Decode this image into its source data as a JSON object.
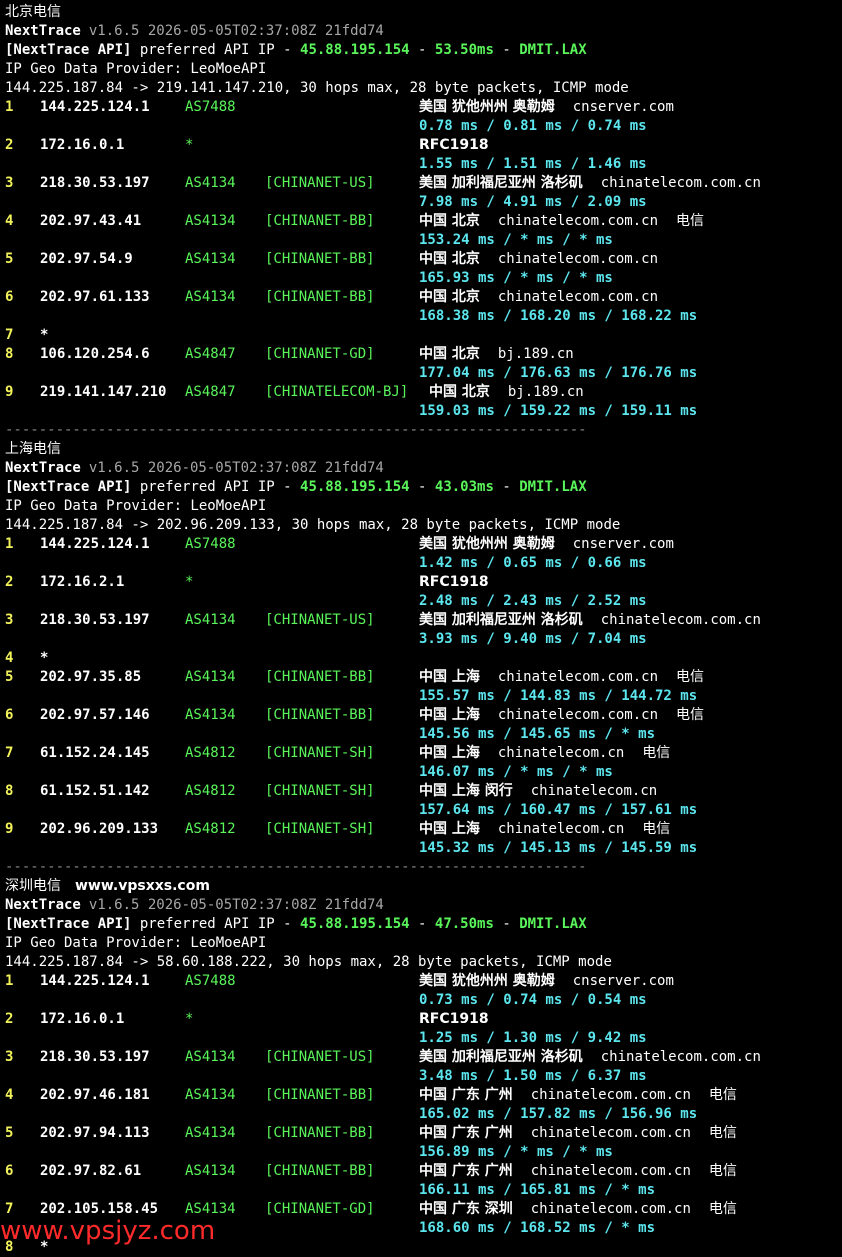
{
  "sections": [
    {
      "title": "北京电信",
      "watermark": "",
      "app": "NextTrace",
      "version": "v1.6.5 2026-05-05T02:37:08Z 21fdd74",
      "api_tag": "[NextTrace API]",
      "api_text": " preferred API IP - ",
      "api_ip": "45.88.195.154",
      "dash1": " - ",
      "api_latency": "53.50ms",
      "dash2": " - ",
      "api_node": "DMIT.LAX",
      "provider": "IP Geo Data Provider: LeoMoeAPI",
      "trace": "144.225.187.84 -> 219.141.147.210, 30 hops max, 28 byte packets, ICMP mode",
      "hops": [
        {
          "n": "1",
          "ip": "144.225.124.1",
          "as": "AS7488",
          "net": "",
          "geo": "美国 犹他州州 奥勒姆",
          "host": "cnserver.com",
          "isp": "",
          "rtt": "0.78 ms / 0.81 ms / 0.74 ms"
        },
        {
          "n": "2",
          "ip": "172.16.0.1",
          "as": "*",
          "net": "",
          "geo": "RFC1918",
          "host": "",
          "isp": "",
          "rtt": "1.55 ms / 1.51 ms / 1.46 ms"
        },
        {
          "n": "3",
          "ip": "218.30.53.197",
          "as": "AS4134",
          "net": "[CHINANET-US]",
          "geo": "美国 加利福尼亚州 洛杉矶",
          "host": "chinatelecom.com.cn",
          "isp": "",
          "rtt": "7.98 ms / 4.91 ms / 2.09 ms"
        },
        {
          "n": "4",
          "ip": "202.97.43.41",
          "as": "AS4134",
          "net": "[CHINANET-BB]",
          "geo": "中国 北京",
          "host": "chinatelecom.com.cn",
          "isp": "电信",
          "rtt": "153.24 ms / * ms / * ms"
        },
        {
          "n": "5",
          "ip": "202.97.54.9",
          "as": "AS4134",
          "net": "[CHINANET-BB]",
          "geo": "中国 北京",
          "host": "chinatelecom.com.cn",
          "isp": "",
          "rtt": "165.93 ms / * ms / * ms"
        },
        {
          "n": "6",
          "ip": "202.97.61.133",
          "as": "AS4134",
          "net": "[CHINANET-BB]",
          "geo": "中国 北京",
          "host": "chinatelecom.com.cn",
          "isp": "",
          "rtt": "168.38 ms / 168.20 ms / 168.22 ms"
        },
        {
          "n": "7",
          "ip": "*",
          "as": "",
          "net": "",
          "geo": "",
          "host": "",
          "isp": "",
          "rtt": ""
        },
        {
          "n": "8",
          "ip": "106.120.254.6",
          "as": "AS4847",
          "net": "[CHINANET-GD]",
          "geo": "中国 北京",
          "host": "bj.189.cn",
          "isp": "",
          "rtt": "177.04 ms / 176.63 ms / 176.76 ms"
        },
        {
          "n": "9",
          "ip": "219.141.147.210",
          "as": "AS4847",
          "net": "[CHINATELECOM-BJ]",
          "geo": "中国 北京",
          "host": "bj.189.cn",
          "isp": "",
          "rtt": "159.03 ms / 159.22 ms / 159.11 ms"
        }
      ]
    },
    {
      "title": "上海电信",
      "watermark": "",
      "app": "NextTrace",
      "version": "v1.6.5 2026-05-05T02:37:08Z 21fdd74",
      "api_tag": "[NextTrace API]",
      "api_text": " preferred API IP - ",
      "api_ip": "45.88.195.154",
      "dash1": " - ",
      "api_latency": "43.03ms",
      "dash2": " - ",
      "api_node": "DMIT.LAX",
      "provider": "IP Geo Data Provider: LeoMoeAPI",
      "trace": "144.225.187.84 -> 202.96.209.133, 30 hops max, 28 byte packets, ICMP mode",
      "hops": [
        {
          "n": "1",
          "ip": "144.225.124.1",
          "as": "AS7488",
          "net": "",
          "geo": "美国 犹他州州 奥勒姆",
          "host": "cnserver.com",
          "isp": "",
          "rtt": "1.42 ms / 0.65 ms / 0.66 ms"
        },
        {
          "n": "2",
          "ip": "172.16.2.1",
          "as": "*",
          "net": "",
          "geo": "RFC1918",
          "host": "",
          "isp": "",
          "rtt": "2.48 ms / 2.43 ms / 2.52 ms"
        },
        {
          "n": "3",
          "ip": "218.30.53.197",
          "as": "AS4134",
          "net": "[CHINANET-US]",
          "geo": "美国 加利福尼亚州 洛杉矶",
          "host": "chinatelecom.com.cn",
          "isp": "",
          "rtt": "3.93 ms / 9.40 ms / 7.04 ms"
        },
        {
          "n": "4",
          "ip": "*",
          "as": "",
          "net": "",
          "geo": "",
          "host": "",
          "isp": "",
          "rtt": ""
        },
        {
          "n": "5",
          "ip": "202.97.35.85",
          "as": "AS4134",
          "net": "[CHINANET-BB]",
          "geo": "中国 上海",
          "host": "chinatelecom.com.cn",
          "isp": "电信",
          "rtt": "155.57 ms / 144.83 ms / 144.72 ms"
        },
        {
          "n": "6",
          "ip": "202.97.57.146",
          "as": "AS4134",
          "net": "[CHINANET-BB]",
          "geo": "中国 上海",
          "host": "chinatelecom.com.cn",
          "isp": "电信",
          "rtt": "145.56 ms / 145.65 ms / * ms"
        },
        {
          "n": "7",
          "ip": "61.152.24.145",
          "as": "AS4812",
          "net": "[CHINANET-SH]",
          "geo": "中国 上海",
          "host": "chinatelecom.cn",
          "isp": "电信",
          "rtt": "146.07 ms / * ms / * ms"
        },
        {
          "n": "8",
          "ip": "61.152.51.142",
          "as": "AS4812",
          "net": "[CHINANET-SH]",
          "geo": "中国 上海 闵行",
          "host": "chinatelecom.cn",
          "isp": "",
          "rtt": "157.64 ms / 160.47 ms / 157.61 ms"
        },
        {
          "n": "9",
          "ip": "202.96.209.133",
          "as": "AS4812",
          "net": "[CHINANET-SH]",
          "geo": "中国 上海",
          "host": "chinatelecom.cn",
          "isp": "电信",
          "rtt": "145.32 ms / 145.13 ms / 145.59 ms"
        }
      ]
    },
    {
      "title": "深圳电信",
      "watermark": "www.vpsxxs.com",
      "app": "NextTrace",
      "version": "v1.6.5 2026-05-05T02:37:08Z 21fdd74",
      "api_tag": "[NextTrace API]",
      "api_text": " preferred API IP - ",
      "api_ip": "45.88.195.154",
      "dash1": " - ",
      "api_latency": "47.50ms",
      "dash2": " - ",
      "api_node": "DMIT.LAX",
      "provider": "IP Geo Data Provider: LeoMoeAPI",
      "trace": "144.225.187.84 -> 58.60.188.222, 30 hops max, 28 byte packets, ICMP mode",
      "hops": [
        {
          "n": "1",
          "ip": "144.225.124.1",
          "as": "AS7488",
          "net": "",
          "geo": "美国 犹他州州 奥勒姆",
          "host": "cnserver.com",
          "isp": "",
          "rtt": "0.73 ms / 0.74 ms / 0.54 ms"
        },
        {
          "n": "2",
          "ip": "172.16.0.1",
          "as": "*",
          "net": "",
          "geo": "RFC1918",
          "host": "",
          "isp": "",
          "rtt": "1.25 ms / 1.30 ms / 9.42 ms"
        },
        {
          "n": "3",
          "ip": "218.30.53.197",
          "as": "AS4134",
          "net": "[CHINANET-US]",
          "geo": "美国 加利福尼亚州 洛杉矶",
          "host": "chinatelecom.com.cn",
          "isp": "",
          "rtt": "3.48 ms / 1.50 ms / 6.37 ms"
        },
        {
          "n": "4",
          "ip": "202.97.46.181",
          "as": "AS4134",
          "net": "[CHINANET-BB]",
          "geo": "中国 广东 广州",
          "host": "chinatelecom.com.cn",
          "isp": "电信",
          "rtt": "165.02 ms / 157.82 ms / 156.96 ms"
        },
        {
          "n": "5",
          "ip": "202.97.94.113",
          "as": "AS4134",
          "net": "[CHINANET-BB]",
          "geo": "中国 广东 广州",
          "host": "chinatelecom.com.cn",
          "isp": "电信",
          "rtt": "156.89 ms / * ms / * ms"
        },
        {
          "n": "6",
          "ip": "202.97.82.61",
          "as": "AS4134",
          "net": "[CHINANET-BB]",
          "geo": "中国 广东 广州",
          "host": "chinatelecom.com.cn",
          "isp": "电信",
          "rtt": "166.11 ms / 165.81 ms / * ms"
        },
        {
          "n": "7",
          "ip": "202.105.158.45",
          "as": "AS4134",
          "net": "[CHINANET-GD]",
          "geo": "中国 广东 深圳",
          "host": "chinatelecom.com.cn",
          "isp": "电信",
          "rtt": "168.60 ms / 168.52 ms / * ms"
        },
        {
          "n": "8",
          "ip": "*",
          "as": "",
          "net": "",
          "geo": "",
          "host": "",
          "isp": "",
          "rtt": ""
        }
      ]
    }
  ],
  "separator": "---------------------------------------------------------------------",
  "bottom_watermark": "www.vpsjyz.com"
}
